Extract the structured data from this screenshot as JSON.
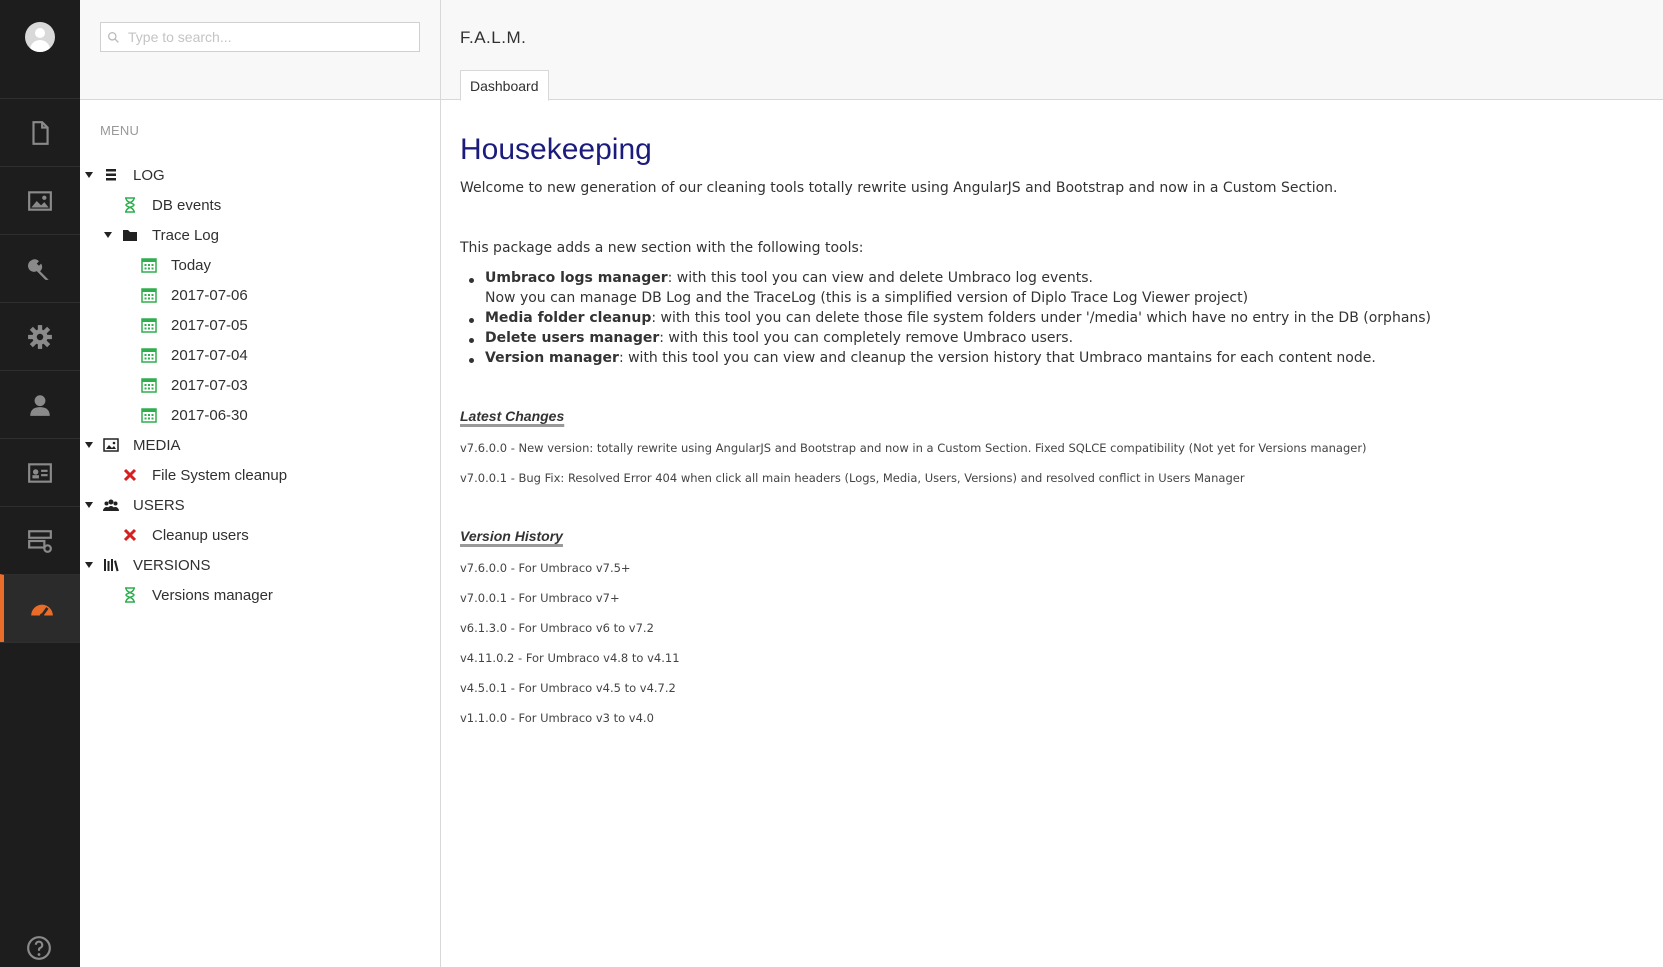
{
  "sections": {
    "items": [
      {
        "name": "content",
        "icon": "document-icon"
      },
      {
        "name": "media",
        "icon": "image-icon"
      },
      {
        "name": "settings",
        "icon": "wrench-icon"
      },
      {
        "name": "developer",
        "icon": "gear-icon"
      },
      {
        "name": "users",
        "icon": "user-icon"
      },
      {
        "name": "members",
        "icon": "id-card-icon"
      },
      {
        "name": "forms",
        "icon": "server-icon"
      },
      {
        "name": "falm",
        "icon": "dashboard-gauge-icon",
        "active": true
      }
    ],
    "help_icon": "help-icon",
    "active_color": "#e96c29"
  },
  "tree": {
    "search_placeholder": "Type to search...",
    "menu_heading": "MENU",
    "nodes": {
      "log": "LOG",
      "db_events": "DB events",
      "trace_log": "Trace Log",
      "today": "Today",
      "d1": "2017-07-06",
      "d2": "2017-07-05",
      "d3": "2017-07-04",
      "d4": "2017-07-03",
      "d5": "2017-06-30",
      "media": "MEDIA",
      "fs_cleanup": "File System cleanup",
      "users": "USERS",
      "cleanup_users": "Cleanup users",
      "versions": "VERSIONS",
      "versions_manager": "Versions manager"
    }
  },
  "header": {
    "page_name": "F.A.L.M.",
    "tab": "Dashboard"
  },
  "dashboard": {
    "title": "Housekeeping",
    "welcome": "Welcome to new generation of our cleaning tools totally rewrite using AngularJS and Bootstrap and now in a Custom Section.",
    "intro": "This package adds a new section with the following tools:",
    "tools": [
      {
        "name": "Umbraco logs manager",
        "text": ": with this tool you can view and delete Umbraco log events."
      },
      {
        "name": "Media folder cleanup",
        "text": ": with this tool you can delete those file system folders under '/media' which have no entry in the DB (orphans)"
      },
      {
        "name": "Delete users manager",
        "text": ": with this tool you can completely remove Umbraco users."
      },
      {
        "name": "Version manager",
        "text": ": with this tool you can view and cleanup the version history that Umbraco mantains for each content node."
      }
    ],
    "tools_note": "Now you can manage DB Log and the TraceLog (this is a simplified version of Diplo Trace Log Viewer project)",
    "latest_changes_heading": "Latest Changes",
    "latest_changes": [
      "v7.6.0.0 - New version: totally rewrite using AngularJS and Bootstrap and now in a Custom Section. Fixed SQLCE compatibility (Not yet for Versions manager)",
      "v7.0.0.1 - Bug Fix: Resolved Error 404 when click all main headers (Logs, Media, Users, Versions) and resolved conflict in Users Manager"
    ],
    "version_history_heading": "Version History",
    "version_history": [
      "v7.6.0.0 - For Umbraco v7.5+",
      "v7.0.0.1 - For Umbraco v7+",
      "v6.1.3.0 - For Umbraco v6 to v7.2",
      "v4.11.0.2 - For Umbraco v4.8 to v4.11",
      "v4.5.0.1 - For Umbraco v4.5 to v4.7.2",
      "v1.1.0.0 - For Umbraco v3 to v4.0"
    ]
  }
}
